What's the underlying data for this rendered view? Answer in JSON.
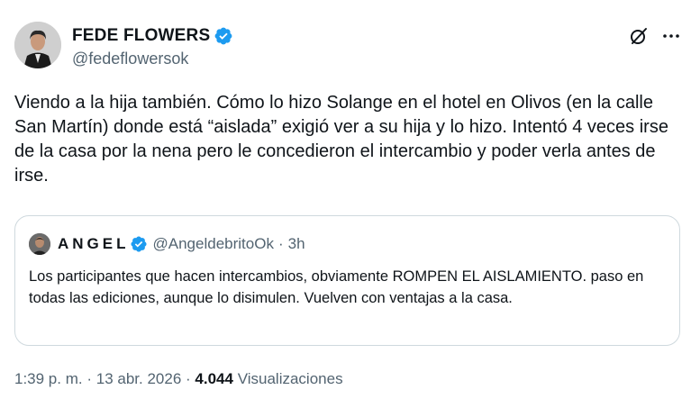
{
  "author": {
    "display_name": "FEDE FLOWERS",
    "handle": "@fedeflowersok"
  },
  "icons": {
    "verified": "verified-badge-icon",
    "grok": "grok-icon",
    "more": "more-options-icon"
  },
  "colors": {
    "verified": "#1d9bf0",
    "secondary_text": "#536471",
    "primary_text": "#0f1419",
    "border": "#cfd9de"
  },
  "tweet": {
    "text": "Viendo a la hija también. Cómo lo hizo Solange en el hotel en Olivos (en la calle San Martín) donde está “aislada” exigió ver a su hija y lo hizo. Intentó 4 veces irse de la casa por la nena pero le concedieron el intercambio y poder verla antes de irse."
  },
  "quote": {
    "display_name": "ANGEL",
    "handle": "@AngeldebritoOk",
    "separator": "·",
    "time": "3h",
    "text": "Los participantes que hacen intercambios, obviamente ROMPEN EL AISLAMIENTO. paso en todas las ediciones, aunque lo disimulen. Vuelven con ventajas a la casa."
  },
  "meta": {
    "time": "1:39 p. m.",
    "date": "13 abr. 2026",
    "separator": "·",
    "views_count": "4.044",
    "views_label": "Visualizaciones"
  }
}
